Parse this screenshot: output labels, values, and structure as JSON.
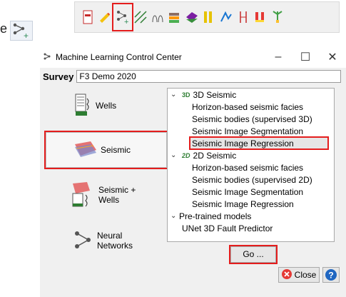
{
  "fragment": {
    "leading_letter": "e"
  },
  "toolbar": {
    "icons": [
      "pdf-icon",
      "pencil-icon",
      "ml-plugin-icon",
      "attribute-icon",
      "well-tie-icon",
      "layers-icon",
      "horizon-icon",
      "fault-icon",
      "curve-icon",
      "seismic-icon",
      "wells-icon",
      "tree-icon"
    ],
    "active_icon": "ml-plugin-icon"
  },
  "window": {
    "title": "Machine Learning Control Center",
    "controls": {
      "minimize": "–",
      "maximize": "☐",
      "close": "✕"
    }
  },
  "survey": {
    "label": "Survey",
    "value": "F3 Demo 2020"
  },
  "side_buttons": [
    {
      "label": "Wells"
    },
    {
      "label": "Seismic",
      "selected": true
    },
    {
      "label": "Seismic +\nWells"
    },
    {
      "label": "Neural\nNetworks"
    }
  ],
  "tree": {
    "groups": [
      {
        "label": "3D Seismic",
        "badge": "3D",
        "items": [
          "Horizon-based seismic facies",
          "Seismic bodies (supervised 3D)",
          "Seismic Image Segmentation",
          "Seismic Image Regression"
        ]
      },
      {
        "label": "2D Seismic",
        "badge": "2D",
        "items": [
          "Horizon-based seismic facies",
          "Seismic bodies (supervised 2D)",
          "Seismic Image Segmentation",
          "Seismic Image Regression"
        ]
      },
      {
        "label": "Pre-trained models",
        "items": [
          "UNet 3D Fault Predictor"
        ]
      }
    ],
    "highlighted_item": "Seismic Image Regression"
  },
  "buttons": {
    "go": "Go ...",
    "close": "Close",
    "help": "?"
  },
  "colors": {
    "highlight": "#e41d1d",
    "close_icon_red": "#e53935",
    "help_blue": "#1f66c1"
  }
}
